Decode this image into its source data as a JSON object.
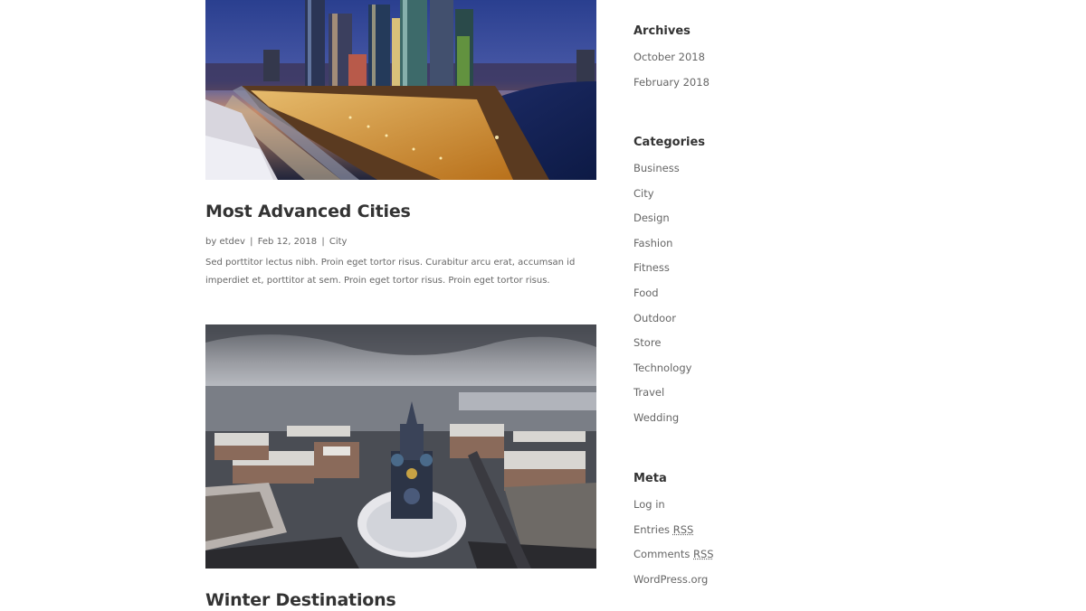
{
  "posts": [
    {
      "title": "Most Advanced Cities",
      "author": "etdev",
      "date": "Feb 12, 2018",
      "category": "City",
      "excerpt": "Sed porttitor lectus nibh. Proin eget tortor risus. Curabitur arcu erat, accumsan id imperdiet et, porttitor at sem. Proin eget tortor risus. Proin eget tortor risus."
    },
    {
      "title": "Winter Destinations"
    }
  ],
  "meta_separator": "|",
  "meta_by": "by",
  "sidebar": {
    "archives": {
      "title": "Archives",
      "items": [
        "October 2018",
        "February 2018"
      ]
    },
    "categories": {
      "title": "Categories",
      "items": [
        "Business",
        "City",
        "Design",
        "Fashion",
        "Fitness",
        "Food",
        "Outdoor",
        "Store",
        "Technology",
        "Travel",
        "Wedding"
      ]
    },
    "meta": {
      "title": "Meta",
      "items": {
        "login": "Log in",
        "entries_prefix": "Entries",
        "comments_prefix": "Comments",
        "rss": "RSS",
        "wordpress": "WordPress.org"
      }
    }
  }
}
